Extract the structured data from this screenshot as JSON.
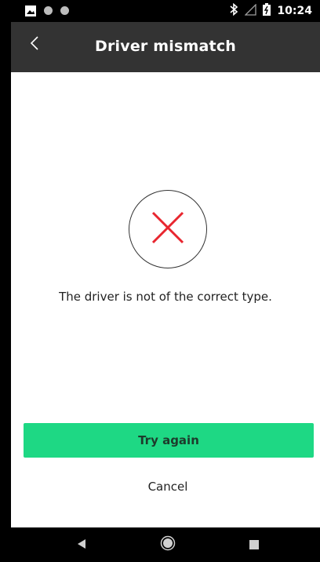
{
  "status_bar": {
    "time": "10:24",
    "icons": [
      "gallery-icon",
      "notification-dot-icon",
      "notification-dot-icon",
      "bluetooth-icon",
      "signal-icon",
      "battery-icon"
    ]
  },
  "header": {
    "title": "Driver mismatch",
    "back_icon": "chevron-left-icon"
  },
  "main": {
    "status_icon": "error-x-icon",
    "message": "The driver is not of the correct type.",
    "primary_button_label": "Try again",
    "secondary_button_label": "Cancel"
  },
  "colors": {
    "header_bg": "#333333",
    "accent_green": "#1ed884",
    "error_red": "#e8262f"
  },
  "nav_bar": {
    "icons": [
      "nav-back-icon",
      "nav-home-icon",
      "nav-recent-icon"
    ]
  }
}
